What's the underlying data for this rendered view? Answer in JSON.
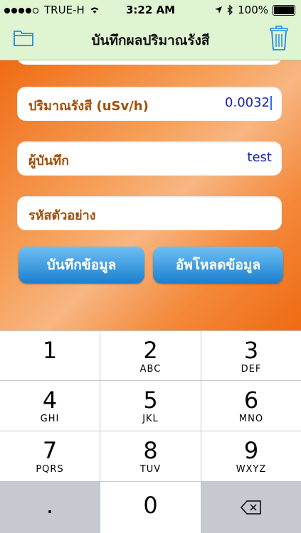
{
  "status_bar": {
    "carrier": "TRUE-H",
    "time": "3:22 AM",
    "battery": "100%"
  },
  "nav": {
    "title": "บันทึกผลปริมาณรังสี",
    "left_icon": "folder-icon",
    "right_icon": "trash-icon"
  },
  "form": {
    "dose_label": "ปริมาณรังสี (uSv/h)",
    "dose_value": "0.0032",
    "recorder_label": "ผู้บันทึก",
    "recorder_value": "test",
    "sample_label": "รหัสตัวอย่าง",
    "sample_value": ""
  },
  "buttons": {
    "save": "บันทึกข้อมูล",
    "upload": "อัพโหลดข้อมูล"
  },
  "keypad": {
    "keys": [
      {
        "num": "1",
        "letters": ""
      },
      {
        "num": "2",
        "letters": "ABC"
      },
      {
        "num": "3",
        "letters": "DEF"
      },
      {
        "num": "4",
        "letters": "GHI"
      },
      {
        "num": "5",
        "letters": "JKL"
      },
      {
        "num": "6",
        "letters": "MNO"
      },
      {
        "num": "7",
        "letters": "PQRS"
      },
      {
        "num": "8",
        "letters": "TUV"
      },
      {
        "num": "9",
        "letters": "WXYZ"
      }
    ],
    "dot": ".",
    "zero": "0",
    "delete_icon": "backspace-icon"
  },
  "colors": {
    "bar_bg": "#dff5d2",
    "label": "#a24f07",
    "value": "#1a23a6",
    "button": "#1b7fcf"
  }
}
